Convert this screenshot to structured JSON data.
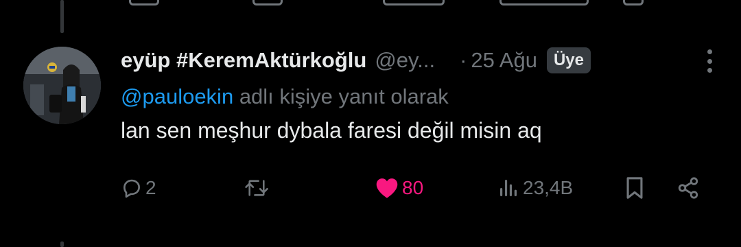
{
  "tweet": {
    "display_name": "eyüp #KeremAktürkoğlu",
    "handle": "@ey...",
    "separator": "·",
    "date": "25 Ağu",
    "badge": "Üye",
    "reply_mention": "@pauloekin",
    "reply_suffix": " adlı kişiye yanıt olarak",
    "text": "lan sen meşhur dybala faresi değil misin aq"
  },
  "actions": {
    "replies": "2",
    "likes": "80",
    "views": "23,4B"
  },
  "colors": {
    "background": "#000000",
    "text": "#e7e9ea",
    "muted": "#71767b",
    "mention": "#1d9bf0",
    "like": "#f91880",
    "badge_bg": "#363b40"
  },
  "icons": {
    "reply": "reply-icon",
    "retweet": "retweet-icon",
    "like": "heart-icon",
    "views": "views-icon",
    "bookmark": "bookmark-icon",
    "share": "share-icon",
    "more": "more-icon"
  }
}
